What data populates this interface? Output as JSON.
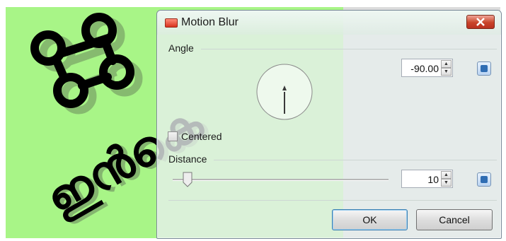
{
  "background_art": {
    "glyph_text": "ഇൻകെ",
    "colors": {
      "canvas_left": "#a8f587",
      "canvas_right": "#dcdcdc"
    }
  },
  "dialog": {
    "title": "Motion Blur",
    "close_icon": "close-icon",
    "angle": {
      "label": "Angle",
      "value": "-90.00",
      "dial_degrees": -90
    },
    "centered": {
      "label": "Centered",
      "checked": false
    },
    "distance": {
      "label": "Distance",
      "value": "10",
      "slider_fraction": 0.05
    },
    "buttons": {
      "ok": "OK",
      "cancel": "Cancel"
    }
  }
}
